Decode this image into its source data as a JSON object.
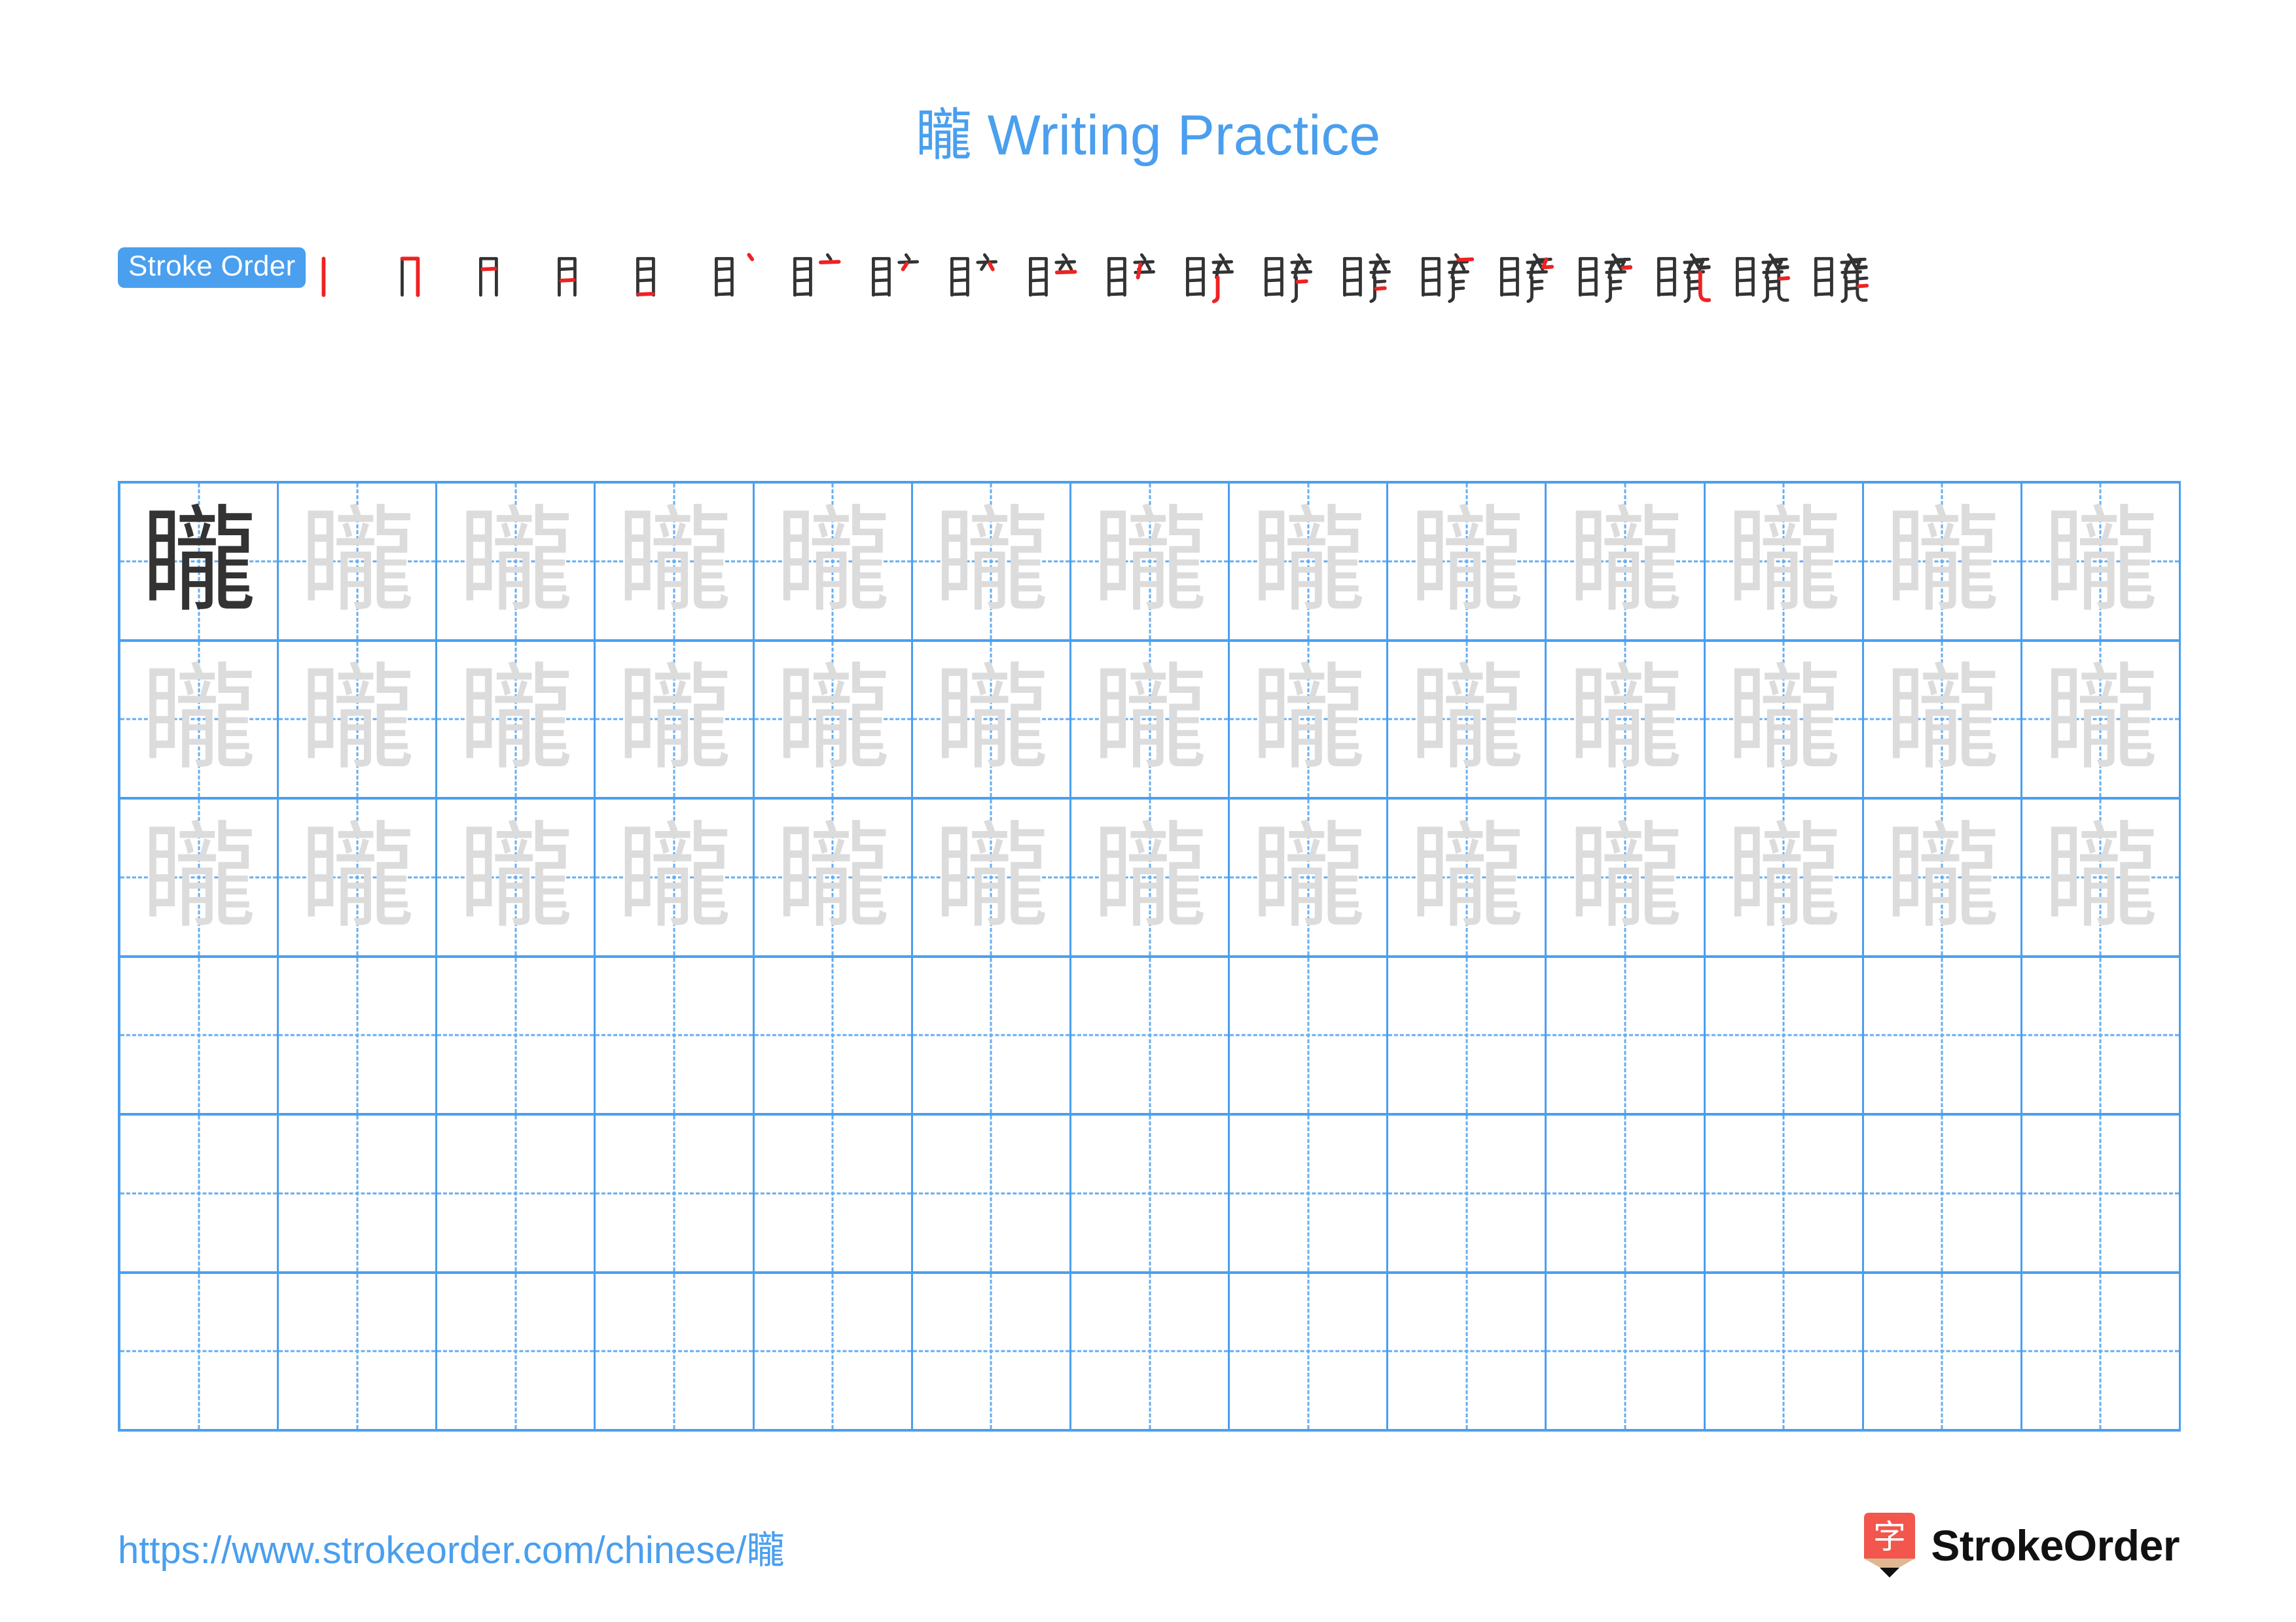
{
  "character": "矓",
  "title": {
    "han": "矓",
    "suffix": " Writing Practice",
    "full": "矓 Writing Practice"
  },
  "colors": {
    "accent_blue": "#4A9FEE",
    "grid_line": "#4A9FEE",
    "grid_dashed": "#63AEF2",
    "stroke_done": "#333333",
    "stroke_new": "#EE2222",
    "trace_gray": "#DCDCDC",
    "logo_red": "#F2564C",
    "logo_wood": "#DEB892",
    "logo_tip": "#111111"
  },
  "stroke_order": {
    "badge_label": "Stroke Order",
    "total_strokes": 20,
    "steps": [
      {
        "index": 1,
        "glyph": "丨"
      },
      {
        "index": 2,
        "glyph": "冂"
      },
      {
        "index": 3,
        "glyph": "月"
      },
      {
        "index": 4,
        "glyph": "月"
      },
      {
        "index": 5,
        "glyph": "目"
      },
      {
        "index": 6,
        "glyph": "目丶"
      },
      {
        "index": 7,
        "glyph": "目亠"
      },
      {
        "index": 8,
        "glyph": "目立"
      },
      {
        "index": 9,
        "glyph": "目产"
      },
      {
        "index": 10,
        "glyph": "目产"
      },
      {
        "index": 11,
        "glyph": "睁"
      },
      {
        "index": 12,
        "glyph": "睁"
      },
      {
        "index": 13,
        "glyph": "睛"
      },
      {
        "index": 14,
        "glyph": "睛"
      },
      {
        "index": 15,
        "glyph": "睛一"
      },
      {
        "index": 16,
        "glyph": "睛与"
      },
      {
        "index": 17,
        "glyph": "睛与"
      },
      {
        "index": 18,
        "glyph": "矓"
      },
      {
        "index": 19,
        "glyph": "矓"
      },
      {
        "index": 20,
        "glyph": "矓"
      }
    ]
  },
  "practice_grid": {
    "columns": 13,
    "rows": 6,
    "rows_data": [
      {
        "row": 1,
        "cells": [
          "dark",
          "light",
          "light",
          "light",
          "light",
          "light",
          "light",
          "light",
          "light",
          "light",
          "light",
          "light",
          "light"
        ]
      },
      {
        "row": 2,
        "cells": [
          "light",
          "light",
          "light",
          "light",
          "light",
          "light",
          "light",
          "light",
          "light",
          "light",
          "light",
          "light",
          "light"
        ]
      },
      {
        "row": 3,
        "cells": [
          "light",
          "light",
          "light",
          "light",
          "light",
          "light",
          "light",
          "light",
          "light",
          "light",
          "light",
          "light",
          "light"
        ]
      },
      {
        "row": 4,
        "cells": [
          "empty",
          "empty",
          "empty",
          "empty",
          "empty",
          "empty",
          "empty",
          "empty",
          "empty",
          "empty",
          "empty",
          "empty",
          "empty"
        ]
      },
      {
        "row": 5,
        "cells": [
          "empty",
          "empty",
          "empty",
          "empty",
          "empty",
          "empty",
          "empty",
          "empty",
          "empty",
          "empty",
          "empty",
          "empty",
          "empty"
        ]
      },
      {
        "row": 6,
        "cells": [
          "empty",
          "empty",
          "empty",
          "empty",
          "empty",
          "empty",
          "empty",
          "empty",
          "empty",
          "empty",
          "empty",
          "empty",
          "empty"
        ]
      }
    ]
  },
  "footer": {
    "url": "https://www.strokeorder.com/chinese/矓",
    "brand_name": "StrokeOrder",
    "brand_logo_glyph": "字"
  }
}
